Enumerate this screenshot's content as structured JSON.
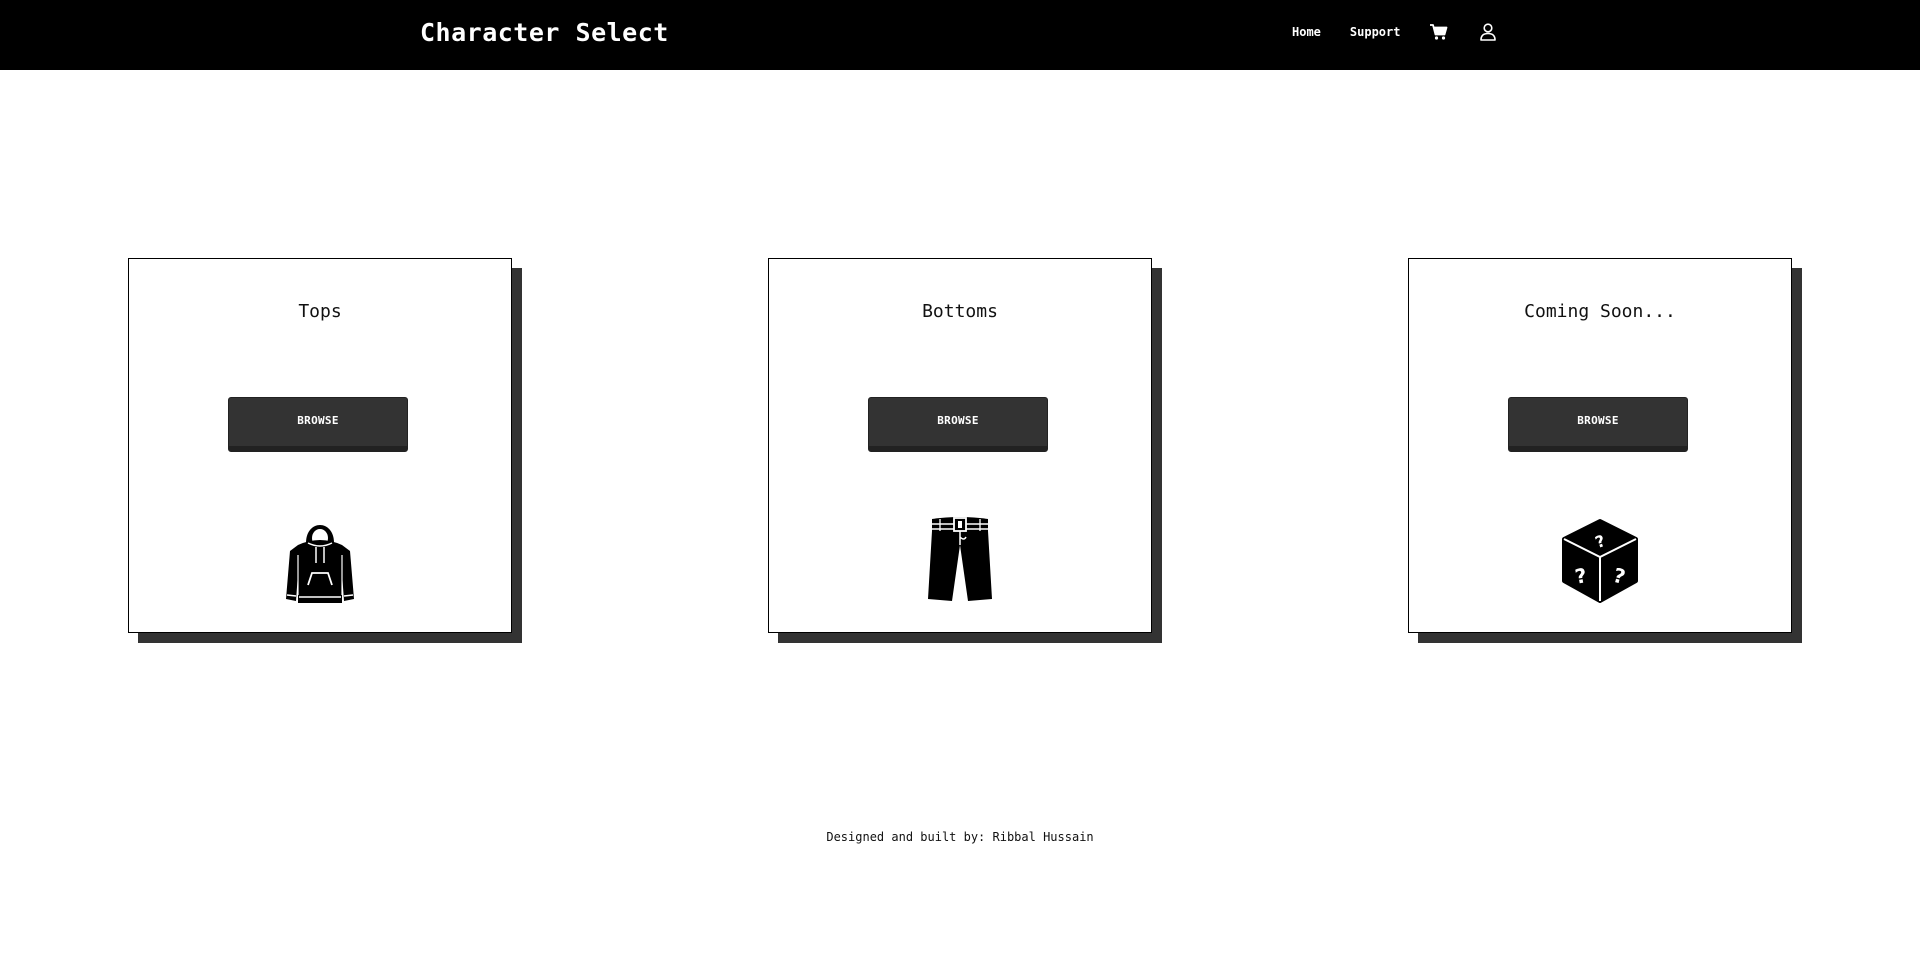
{
  "navbar": {
    "brand": "Character Select",
    "links": [
      {
        "label": "Home"
      },
      {
        "label": "Support"
      }
    ],
    "icons": [
      "cart-icon",
      "user-icon"
    ],
    "background": "#000000",
    "text_color": "#ffffff"
  },
  "cards": [
    {
      "title": "Tops",
      "button_label": "BROWSE",
      "icon": "hoodie-icon"
    },
    {
      "title": "Bottoms",
      "button_label": "BROWSE",
      "icon": "pants-icon"
    },
    {
      "title": "Coming Soon...",
      "button_label": "BROWSE",
      "icon": "mystery-box-icon"
    }
  ],
  "footer": {
    "text": "Designed and built by: Ribbal Hussain"
  },
  "colors": {
    "card_shadow": "#333333",
    "button_bg": "#333333",
    "page_bg": "#ffffff"
  }
}
